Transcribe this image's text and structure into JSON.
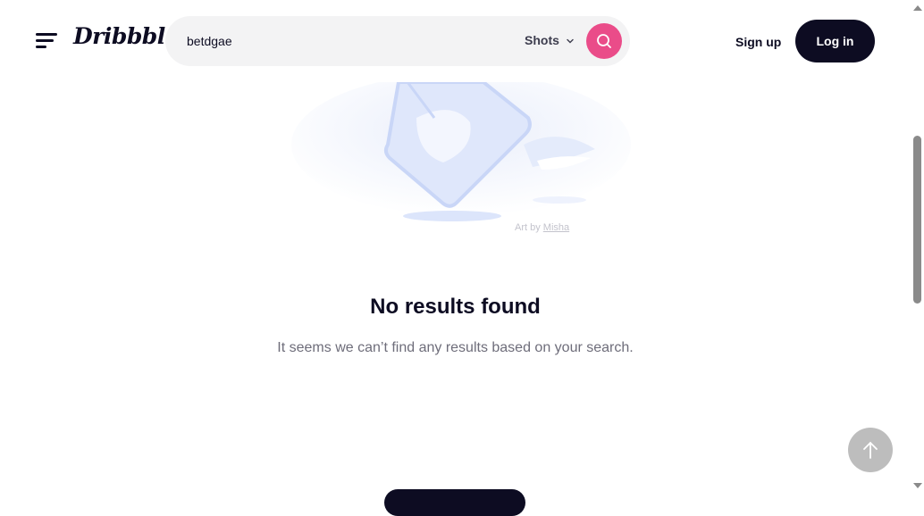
{
  "header": {
    "logo": "Dribbble",
    "search": {
      "value": "betdgae",
      "type_label": "Shots"
    },
    "signup_label": "Sign up",
    "login_label": "Log in"
  },
  "illustration": {
    "credit_prefix": "Art by",
    "credit_author": "Misha"
  },
  "empty_state": {
    "title": "No results found",
    "text": "It seems we can’t find any results based on your search."
  },
  "colors": {
    "accent": "#ea4c89",
    "dark": "#0d0c22",
    "muted": "#6e6d7a"
  },
  "icons": [
    "menu-icon",
    "chevron-down-icon",
    "search-icon",
    "arrow-up-icon"
  ]
}
